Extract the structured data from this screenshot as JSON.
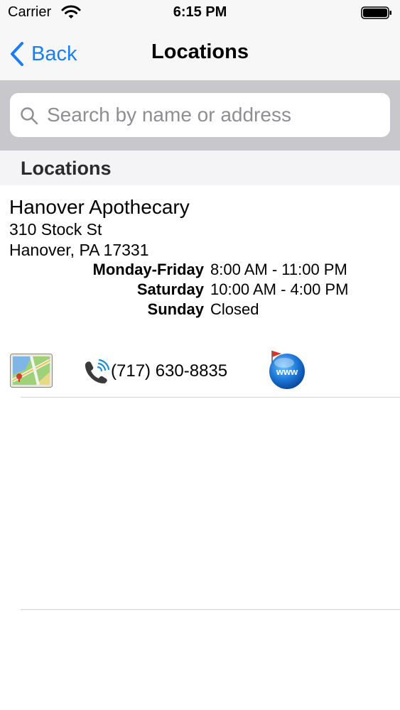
{
  "status_bar": {
    "carrier": "Carrier",
    "time": "6:15 PM"
  },
  "nav": {
    "back_label": "Back",
    "title": "Locations"
  },
  "search": {
    "placeholder": "Search by name or address",
    "value": ""
  },
  "section": {
    "title": "Locations"
  },
  "location": {
    "name": "Hanover Apothecary",
    "street": "310 Stock St",
    "city_line": "Hanover, PA 17331",
    "hours": [
      {
        "day": "Monday-Friday",
        "time": "8:00 AM - 11:00 PM"
      },
      {
        "day": "Saturday",
        "time": "10:00 AM - 4:00 PM"
      },
      {
        "day": "Sunday",
        "time": "Closed"
      }
    ],
    "phone": "(717) 630-8835",
    "web_badge": "www"
  },
  "colors": {
    "accent": "#1a7ef6",
    "bar_background": "#f7f7f7",
    "search_area": "#c8c8cc"
  },
  "icons": [
    "wifi-icon",
    "battery-icon",
    "back-chevron-icon",
    "search-icon",
    "map-icon",
    "phone-icon",
    "web-icon"
  ]
}
